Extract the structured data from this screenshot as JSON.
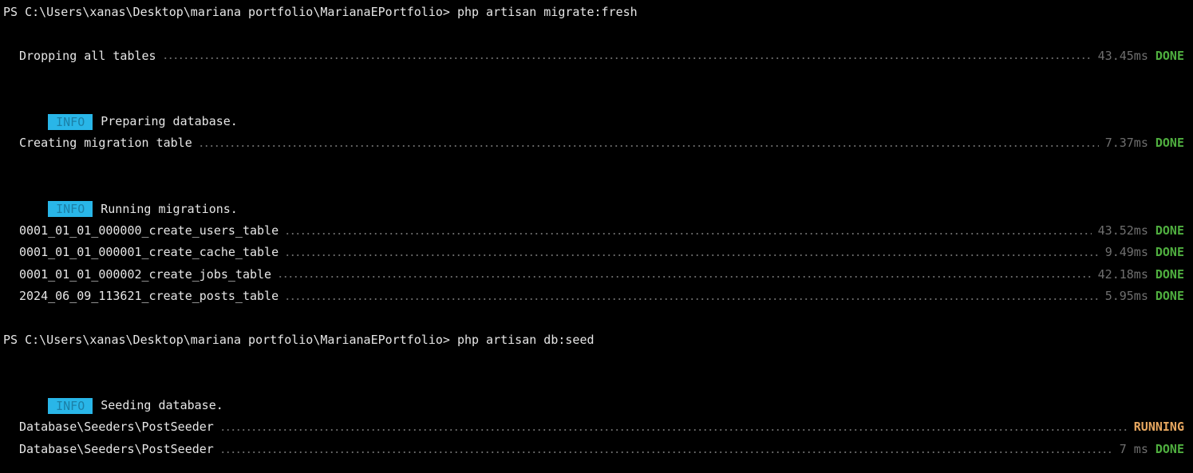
{
  "session1": {
    "prompt": "PS C:\\Users\\xanas\\Desktop\\mariana portfolio\\MarianaEPortfolio> php artisan migrate:fresh",
    "drop": {
      "label": "Dropping all tables",
      "time": "43.45ms",
      "status": "DONE"
    },
    "info_prepare": {
      "badge": "INFO",
      "text": "Preparing database."
    },
    "create_table": {
      "label": "Creating migration table",
      "time": "7.37ms",
      "status": "DONE"
    },
    "info_running": {
      "badge": "INFO",
      "text": "Running migrations."
    },
    "migrations": [
      {
        "label": "0001_01_01_000000_create_users_table",
        "time": "43.52ms",
        "status": "DONE"
      },
      {
        "label": "0001_01_01_000001_create_cache_table",
        "time": "9.49ms",
        "status": "DONE"
      },
      {
        "label": "0001_01_01_000002_create_jobs_table",
        "time": "42.18ms",
        "status": "DONE"
      },
      {
        "label": "2024_06_09_113621_create_posts_table",
        "time": "5.95ms",
        "status": "DONE"
      }
    ]
  },
  "session2": {
    "prompt": "PS C:\\Users\\xanas\\Desktop\\mariana portfolio\\MarianaEPortfolio> php artisan db:seed",
    "info_seeding": {
      "badge": "INFO",
      "text": "Seeding database."
    },
    "seeders": [
      {
        "label": "Database\\Seeders\\PostSeeder",
        "time": "",
        "status": "RUNNING"
      },
      {
        "label": "Database\\Seeders\\PostSeeder",
        "time": "7 ms",
        "status": "DONE"
      }
    ]
  },
  "colors": {
    "background": "#000000",
    "done": "#4fae3f",
    "running": "#e8a860",
    "info_badge": "#29b6e8",
    "time": "#6f6f6f"
  }
}
